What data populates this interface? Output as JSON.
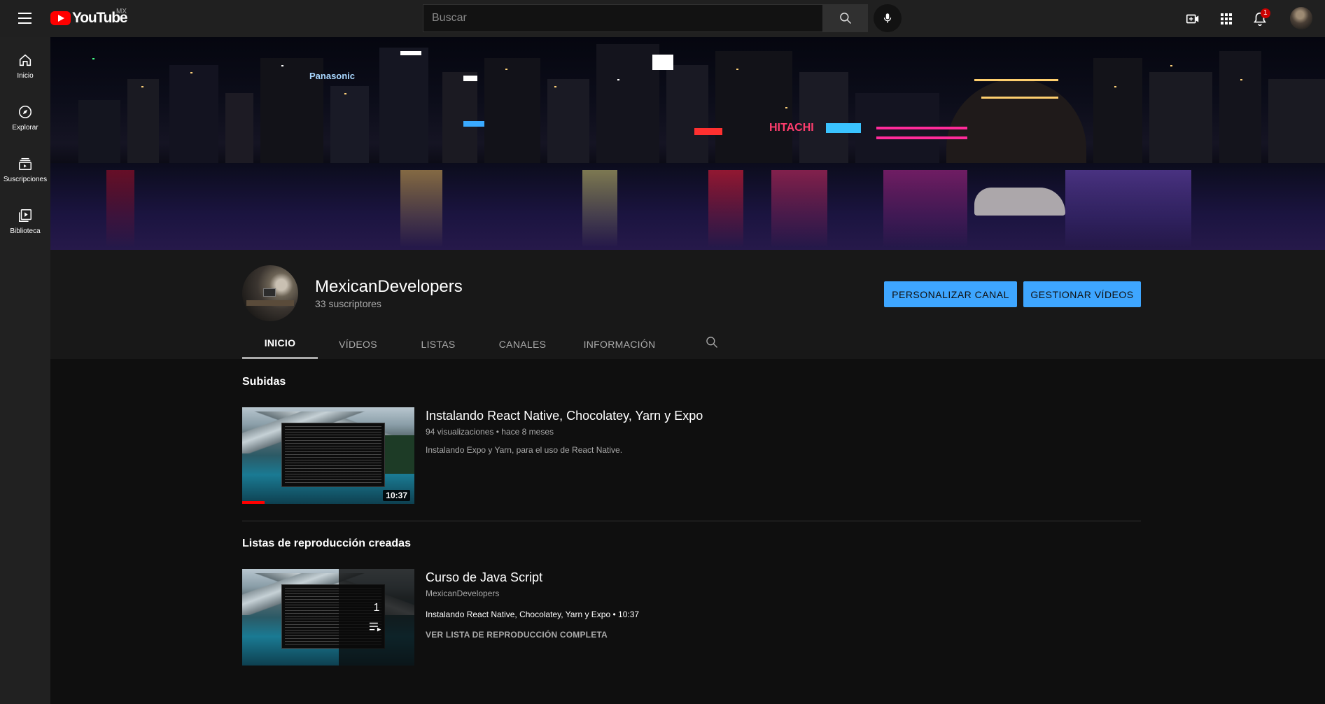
{
  "header": {
    "logo_text": "YouTube",
    "country_code": "MX",
    "search_placeholder": "Buscar",
    "notification_count": "1",
    "icons": [
      "menu-icon",
      "search-icon",
      "mic-icon",
      "create-video-icon",
      "apps-grid-icon",
      "bell-icon"
    ]
  },
  "sidebar": {
    "items": [
      {
        "label": "Inicio",
        "icon": "home-icon"
      },
      {
        "label": "Explorar",
        "icon": "compass-icon"
      },
      {
        "label": "Suscripciones",
        "icon": "subscriptions-icon"
      },
      {
        "label": "Biblioteca",
        "icon": "library-icon"
      }
    ]
  },
  "banner": {
    "neon_signs": [
      "HITACHI",
      "Panasonic"
    ]
  },
  "channel": {
    "name": "MexicanDevelopers",
    "subscribers": "33 suscriptores",
    "customize_label": "PERSONALIZAR CANAL",
    "manage_label": "GESTIONAR VÍDEOS"
  },
  "tabs": [
    {
      "label": "INICIO",
      "active": true
    },
    {
      "label": "VÍDEOS",
      "active": false
    },
    {
      "label": "LISTAS",
      "active": false
    },
    {
      "label": "CANALES",
      "active": false
    },
    {
      "label": "INFORMACIÓN",
      "active": false
    }
  ],
  "uploads": {
    "section_title": "Subidas",
    "video": {
      "title": "Instalando React Native, Chocolatey, Yarn y Expo",
      "views": "94 visualizaciones",
      "age": "hace 8 meses",
      "separator": "•",
      "description": "Instalando Expo y Yarn, para el uso de React Native.",
      "duration": "10:37",
      "watched_fraction": 0.13
    }
  },
  "playlists": {
    "section_title": "Listas de reproducción creadas",
    "playlist": {
      "title": "Curso de Java Script",
      "channel": "MexicanDevelopers",
      "count": "1",
      "first_item": "Instalando React Native, Chocolatey, Yarn y Expo",
      "first_item_duration": "10:37",
      "separator": "•",
      "view_full": "VER LISTA DE REPRODUCCIÓN COMPLETA"
    }
  },
  "colors": {
    "accent_blue": "#3ea6ff",
    "brand_red": "#ff0000",
    "background": "#181818",
    "topbar": "#202020"
  }
}
